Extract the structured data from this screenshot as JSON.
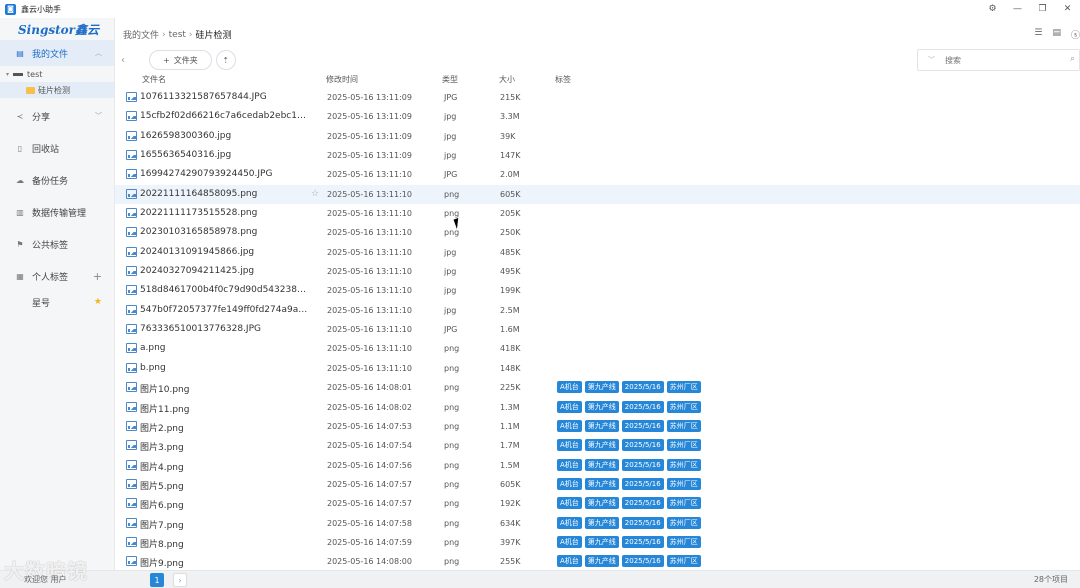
{
  "window": {
    "title": "鑫云小助手",
    "app_icon": "app-icon"
  },
  "sidebar": {
    "logo": "Singstor鑫云",
    "my_files": "我的文件",
    "tree": [
      {
        "label": "test"
      },
      {
        "label": "硅片检测"
      }
    ],
    "share": "分享",
    "recycle": "回收站",
    "backup": "备份任务",
    "transfer": "数据传输管理",
    "public_tags": "公共标签",
    "personal_tags": "个人标签",
    "star": "星号"
  },
  "breadcrumb": {
    "root": "我的文件",
    "level1": "test",
    "current": "硅片检测"
  },
  "toolbar": {
    "new_folder": "文件夹"
  },
  "search": {
    "placeholder": "搜索"
  },
  "columns": {
    "name": "文件名",
    "time": "修改时间",
    "type": "类型",
    "size": "大小",
    "tags": "标签"
  },
  "files": [
    {
      "name": "1076113321587657844.JPG",
      "time": "2025-05-16 13:11:09",
      "type": "JPG",
      "size": "215K"
    },
    {
      "name": "15cfb2f02d66216c7a6cedab2ebc1e26...",
      "time": "2025-05-16 13:11:09",
      "type": "jpg",
      "size": "3.3M"
    },
    {
      "name": "1626598300360.jpg",
      "time": "2025-05-16 13:11:09",
      "type": "jpg",
      "size": "39K"
    },
    {
      "name": "1655636540316.jpg",
      "time": "2025-05-16 13:11:09",
      "type": "jpg",
      "size": "147K"
    },
    {
      "name": "1699427429079392445​0.JPG",
      "time": "2025-05-16 13:11:10",
      "type": "JPG",
      "size": "2.0M"
    },
    {
      "name": "20221111164858095.png",
      "time": "2025-05-16 13:11:10",
      "type": "png",
      "size": "605K"
    },
    {
      "name": "20221111173515528.png",
      "time": "2025-05-16 13:11:10",
      "type": "png",
      "size": "205K"
    },
    {
      "name": "20230103165858978.png",
      "time": "2025-05-16 13:11:10",
      "type": "png",
      "size": "250K"
    },
    {
      "name": "20240131091945866.jpg",
      "time": "2025-05-16 13:11:10",
      "type": "jpg",
      "size": "485K"
    },
    {
      "name": "20240327094211425.jpg",
      "time": "2025-05-16 13:11:10",
      "type": "jpg",
      "size": "495K"
    },
    {
      "name": "518d8461700b4f0c79d90d543238bad...",
      "time": "2025-05-16 13:11:10",
      "type": "jpg",
      "size": "199K"
    },
    {
      "name": "547b0f72057377fe149ff0fd274a9a13.j...",
      "time": "2025-05-16 13:11:10",
      "type": "jpg",
      "size": "2.5M"
    },
    {
      "name": "7633365100137763​28.JPG",
      "time": "2025-05-16 13:11:10",
      "type": "JPG",
      "size": "1.6M"
    },
    {
      "name": "a.png",
      "time": "2025-05-16 13:11:10",
      "type": "png",
      "size": "418K"
    },
    {
      "name": "b.png",
      "time": "2025-05-16 13:11:10",
      "type": "png",
      "size": "148K"
    },
    {
      "name": "图片10.png",
      "time": "2025-05-16 14:08:01",
      "type": "png",
      "size": "225K",
      "tags": [
        "A机台",
        "第九产线",
        "2025/5/16",
        "苏州厂区"
      ]
    },
    {
      "name": "图片11.png",
      "time": "2025-05-16 14:08:02",
      "type": "png",
      "size": "1.3M",
      "tags": [
        "A机台",
        "第九产线",
        "2025/5/16",
        "苏州厂区"
      ]
    },
    {
      "name": "图片2.png",
      "time": "2025-05-16 14:07:53",
      "type": "png",
      "size": "1.1M",
      "tags": [
        "A机台",
        "第九产线",
        "2025/5/16",
        "苏州厂区"
      ]
    },
    {
      "name": "图片3.png",
      "time": "2025-05-16 14:07:54",
      "type": "png",
      "size": "1.7M",
      "tags": [
        "A机台",
        "第九产线",
        "2025/5/16",
        "苏州厂区"
      ]
    },
    {
      "name": "图片4.png",
      "time": "2025-05-16 14:07:56",
      "type": "png",
      "size": "1.5M",
      "tags": [
        "A机台",
        "第九产线",
        "2025/5/16",
        "苏州厂区"
      ]
    },
    {
      "name": "图片5.png",
      "time": "2025-05-16 14:07:57",
      "type": "png",
      "size": "605K",
      "tags": [
        "A机台",
        "第九产线",
        "2025/5/16",
        "苏州厂区"
      ]
    },
    {
      "name": "图片6.png",
      "time": "2025-05-16 14:07:57",
      "type": "png",
      "size": "192K",
      "tags": [
        "A机台",
        "第九产线",
        "2025/5/16",
        "苏州厂区"
      ]
    },
    {
      "name": "图片7.png",
      "time": "2025-05-16 14:07:58",
      "type": "png",
      "size": "634K",
      "tags": [
        "A机台",
        "第九产线",
        "2025/5/16",
        "苏州厂区"
      ]
    },
    {
      "name": "图片8.png",
      "time": "2025-05-16 14:07:59",
      "type": "png",
      "size": "397K",
      "tags": [
        "A机台",
        "第九产线",
        "2025/5/16",
        "苏州厂区"
      ]
    },
    {
      "name": "图片9.png",
      "time": "2025-05-16 14:08:00",
      "type": "png",
      "size": "255K",
      "tags": [
        "A机台",
        "第九产线",
        "2025/5/16",
        "苏州厂区"
      ]
    }
  ],
  "hover_row": 5,
  "status": {
    "welcome": "欢迎您 用户",
    "watermark": "大数暗镜",
    "page": "1",
    "item_count": "28个项目"
  },
  "colors": {
    "accent": "#1d6cc7",
    "tag": "#2687d8"
  }
}
